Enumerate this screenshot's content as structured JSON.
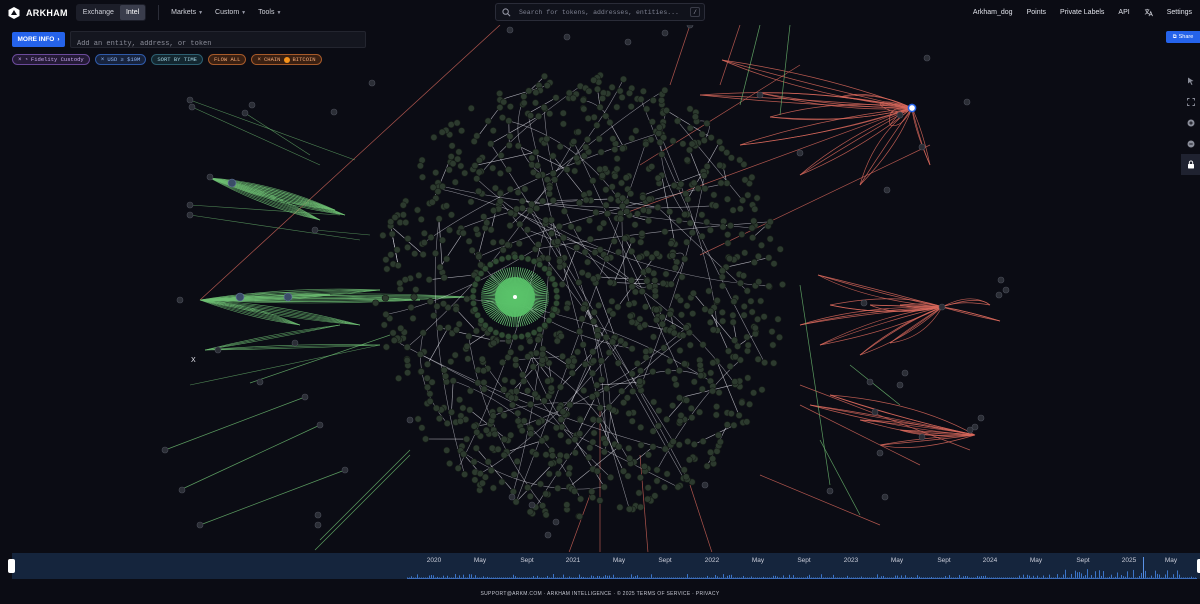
{
  "brand": {
    "name": "ARKHAM"
  },
  "mode_toggle": {
    "options": [
      "Exchange",
      "Intel"
    ],
    "selected": "Intel"
  },
  "nav": {
    "markets": "Markets",
    "custom": "Custom",
    "tools": "Tools"
  },
  "search": {
    "placeholder": "Search for tokens, addresses, entities...",
    "shortcut": "/"
  },
  "right_nav": {
    "user": "Arkham_dog",
    "points": "Points",
    "private_labels": "Private Labels",
    "api": "API",
    "settings": "Settings"
  },
  "toolbar": {
    "more_info": "MORE INFO",
    "entity_placeholder": "Add an entity, address, or token",
    "share": "Share"
  },
  "filters": [
    {
      "label": "Fidelity Custody",
      "style": "purple"
    },
    {
      "label": "USD ≥ $10M",
      "style": "blue"
    },
    {
      "label": "SORT BY TIME",
      "style": "teal"
    },
    {
      "label": "FLOW ALL",
      "style": "orange"
    },
    {
      "label": "CHAIN",
      "token": "BITCOIN",
      "style": "orange"
    }
  ],
  "graph": {
    "edge_colors": {
      "inflow": "#6fbf73",
      "outflow": "#d9685c",
      "neutral": "#e6e6ee"
    },
    "node_color": "#2c3a2e",
    "center_color": "#58c168",
    "marker_x": "X"
  },
  "tools": [
    "cursor-icon",
    "fit-icon",
    "zoom-in-icon",
    "zoom-out-icon",
    "lock-icon"
  ],
  "timeline": {
    "labels": [
      "2020",
      "May",
      "Sept",
      "2021",
      "May",
      "Sept",
      "2022",
      "May",
      "Sept",
      "2023",
      "May",
      "Sept",
      "2024",
      "May",
      "Sept",
      "2025",
      "May"
    ]
  },
  "footer": {
    "text": "SUPPORT@ARKM.COM · ARKHAM INTELLIGENCE · © 2025 TERMS OF SERVICE · PRIVACY"
  }
}
